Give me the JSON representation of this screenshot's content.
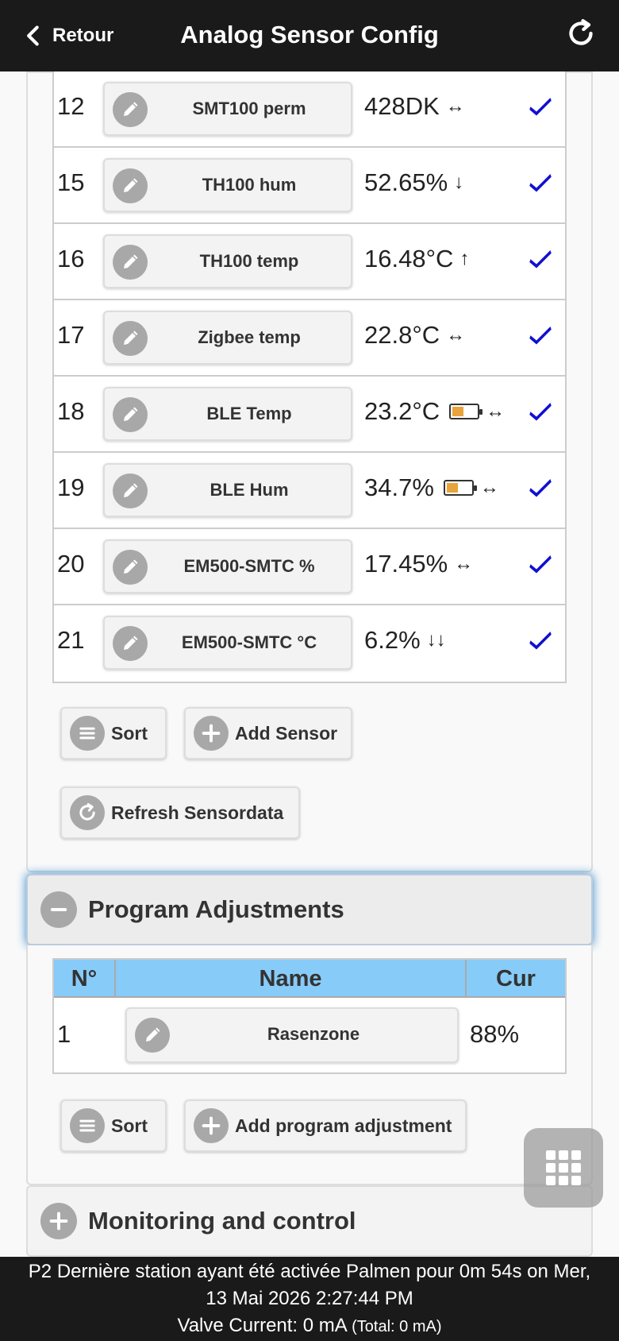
{
  "header": {
    "back_label": "Retour",
    "title": "Analog Sensor Config"
  },
  "sensors": [
    {
      "nr": "12",
      "name": "SMT100 perm",
      "value": "428DK",
      "battery": false,
      "trend": "↔"
    },
    {
      "nr": "15",
      "name": "TH100 hum",
      "value": "52.65%",
      "battery": false,
      "trend": "↓"
    },
    {
      "nr": "16",
      "name": "TH100 temp",
      "value": "16.48°C",
      "battery": false,
      "trend": "↑"
    },
    {
      "nr": "17",
      "name": "Zigbee temp",
      "value": "22.8°C",
      "battery": false,
      "trend": "↔"
    },
    {
      "nr": "18",
      "name": "BLE Temp",
      "value": "23.2°C",
      "battery": true,
      "trend": "↔"
    },
    {
      "nr": "19",
      "name": "BLE Hum",
      "value": "34.7%",
      "battery": true,
      "trend": "↔"
    },
    {
      "nr": "20",
      "name": "EM500-SMTC %",
      "value": "17.45%",
      "battery": false,
      "trend": "↔"
    },
    {
      "nr": "21",
      "name": "EM500-SMTC °C",
      "value": "6.2%",
      "battery": false,
      "trend": "↓↓"
    }
  ],
  "sensor_buttons": {
    "sort": "Sort",
    "add": "Add Sensor",
    "refresh": "Refresh Sensordata"
  },
  "program_adjustments": {
    "title": "Program Adjustments",
    "columns": [
      "N°",
      "Name",
      "Cur"
    ],
    "rows": [
      {
        "nr": "1",
        "name": "Rasenzone",
        "cur": "88%"
      }
    ],
    "sort": "Sort",
    "add": "Add program adjustment"
  },
  "monitoring": {
    "title": "Monitoring and control"
  },
  "footer": {
    "line1": "P2 Dernière station ayant été activée Palmen pour 0m 54s on Mer,",
    "line2": "13 Mai 2026 2:27:44 PM",
    "line3": "Valve Current: 0 mA",
    "line3_total": "(Total: 0 mA)"
  },
  "colors": {
    "header_bg": "#1a1a1a",
    "table_head_bg": "#87cbf9",
    "check": "#1010d0",
    "battery_fill": "#e8a33c"
  }
}
